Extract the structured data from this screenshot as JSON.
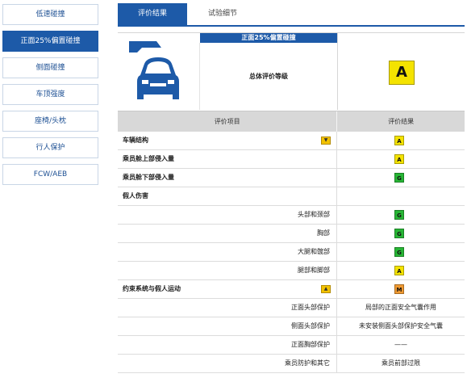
{
  "sidebar": {
    "items": [
      {
        "label": "低速碰撞",
        "active": false
      },
      {
        "label": "正面25%偏置碰撞",
        "active": true
      },
      {
        "label": "侧面碰撞",
        "active": false
      },
      {
        "label": "车顶强度",
        "active": false
      },
      {
        "label": "座椅/头枕",
        "active": false
      },
      {
        "label": "行人保护",
        "active": false
      },
      {
        "label": "FCW/AEB",
        "active": false
      }
    ]
  },
  "tabs": {
    "result": "评价结果",
    "details": "试验细节"
  },
  "header": {
    "banner": "正面25%偏置碰撞",
    "overall_label": "总体评价等级",
    "overall_grade": "A"
  },
  "columns": {
    "item": "评价项目",
    "result": "评价结果"
  },
  "rows": [
    {
      "label": "车辆结构",
      "grade": "A"
    },
    {
      "label": "乘员舱上部侵入量",
      "grade": "A"
    },
    {
      "label": "乘员舱下部侵入量",
      "grade": "G"
    },
    {
      "label": "假人伤害"
    },
    {
      "label": "头部和颈部",
      "grade": "G"
    },
    {
      "label": "胸部",
      "grade": "G"
    },
    {
      "label": "大腿和髋部",
      "grade": "G"
    },
    {
      "label": "腿部和脚部",
      "grade": "A"
    },
    {
      "label": "约束系统与假人运动",
      "grade": "M"
    },
    {
      "label": "正面头部保护",
      "text": "局部的正面安全气囊作用"
    },
    {
      "label": "侧面头部保护",
      "text": "未安装侧面头部保护安全气囊"
    },
    {
      "label": "正面胸部保护",
      "text": "——"
    },
    {
      "label": "乘员防护和其它",
      "text": "乘员前部过限"
    }
  ],
  "colors": {
    "brand_blue": "#1d5aa8",
    "grade_A": "#f4e300",
    "grade_G": "#27b635",
    "grade_M": "#f09a32"
  }
}
